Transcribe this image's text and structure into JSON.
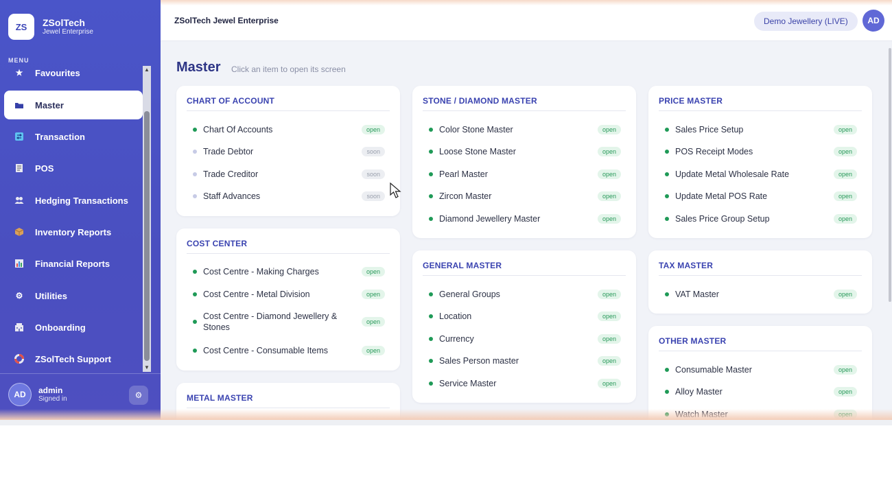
{
  "brand": {
    "logo": "ZS",
    "name": "ZSolTech",
    "subtitle": "Jewel Enterprise"
  },
  "sidebar": {
    "menu_label": "MENU",
    "items": [
      {
        "label": "Favourites",
        "icon": "star-icon",
        "active": false
      },
      {
        "label": "Master",
        "icon": "folder-icon",
        "active": true
      },
      {
        "label": "Transaction",
        "icon": "exchange-icon",
        "active": false
      },
      {
        "label": "POS",
        "icon": "receipt-icon",
        "active": false
      },
      {
        "label": "Hedging Transactions",
        "icon": "users-icon",
        "active": false
      },
      {
        "label": "Inventory Reports",
        "icon": "box-icon",
        "active": false
      },
      {
        "label": "Financial Reports",
        "icon": "bar-chart-icon",
        "active": false
      },
      {
        "label": "Utilities",
        "icon": "gear-icon",
        "active": false
      },
      {
        "label": "Onboarding",
        "icon": "building-icon",
        "active": false
      },
      {
        "label": "ZSolTech Support",
        "icon": "lifebuoy-icon",
        "active": false
      }
    ],
    "user": {
      "initials": "AD",
      "name": "admin",
      "status": "Signed in"
    }
  },
  "header": {
    "title": "ZSolTech Jewel Enterprise",
    "company": "Demo Jewellery (LIVE)",
    "avatar": "AD"
  },
  "main": {
    "title": "Master",
    "subtitle": "Click an item to open its screen",
    "cards": [
      {
        "title": "CHART OF ACCOUNT",
        "items": [
          {
            "label": "Chart Of Accounts",
            "status": "open"
          },
          {
            "label": "Trade Debtor",
            "status": "soon"
          },
          {
            "label": "Trade Creditor",
            "status": "soon"
          },
          {
            "label": "Staff Advances",
            "status": "soon"
          }
        ]
      },
      {
        "title": "COST CENTER",
        "items": [
          {
            "label": "Cost Centre - Making Charges",
            "status": "open"
          },
          {
            "label": "Cost Centre - Metal Division",
            "status": "open"
          },
          {
            "label": "Cost Centre - Diamond Jewellery & Stones",
            "status": "open"
          },
          {
            "label": "Cost Centre - Consumable Items",
            "status": "open"
          }
        ]
      },
      {
        "title": "METAL MASTER",
        "items": []
      },
      {
        "title": "STONE / DIAMOND MASTER",
        "items": [
          {
            "label": "Color Stone Master",
            "status": "open"
          },
          {
            "label": "Loose Stone Master",
            "status": "open"
          },
          {
            "label": "Pearl Master",
            "status": "open"
          },
          {
            "label": "Zircon Master",
            "status": "open"
          },
          {
            "label": "Diamond Jewellery Master",
            "status": "open"
          }
        ]
      },
      {
        "title": "GENERAL MASTER",
        "items": [
          {
            "label": "General Groups",
            "status": "open"
          },
          {
            "label": "Location",
            "status": "open"
          },
          {
            "label": "Currency",
            "status": "open"
          },
          {
            "label": "Sales Person master",
            "status": "open"
          },
          {
            "label": "Service Master",
            "status": "open"
          }
        ]
      },
      {
        "title": "PRICE MASTER",
        "items": [
          {
            "label": "Sales Price Setup",
            "status": "open"
          },
          {
            "label": "POS Receipt Modes",
            "status": "open"
          },
          {
            "label": "Update Metal Wholesale Rate",
            "status": "open"
          },
          {
            "label": "Update Metal POS Rate",
            "status": "open"
          },
          {
            "label": "Sales Price Group Setup",
            "status": "open"
          }
        ]
      },
      {
        "title": "TAX MASTER",
        "items": [
          {
            "label": "VAT Master",
            "status": "open"
          }
        ]
      },
      {
        "title": "OTHER MASTER",
        "items": [
          {
            "label": "Consumable Master",
            "status": "open"
          },
          {
            "label": "Alloy Master",
            "status": "open"
          },
          {
            "label": "Watch Master",
            "status": "open"
          }
        ]
      }
    ]
  }
}
